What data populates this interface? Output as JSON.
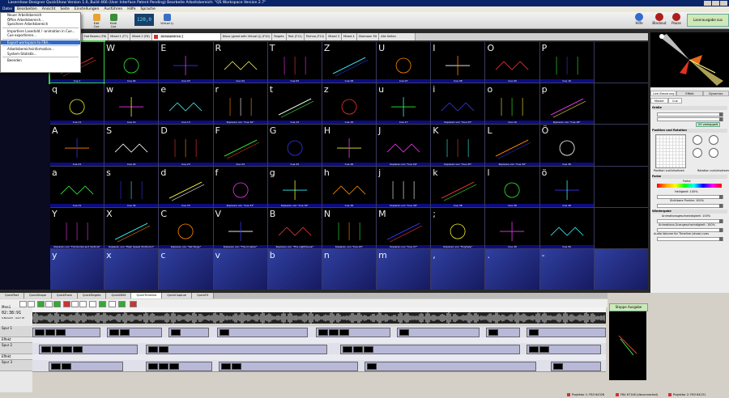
{
  "window": {
    "title": "Lasershow-Designer QuickShow   Version 1.0, Build 466   (User Interface Patent Pending)   Bearbeite Arbeitsbereich: \"QS Workspace Version 2.7\""
  },
  "menu": [
    "Datei",
    "Bearbeiten",
    "Ansicht",
    "Seite",
    "Einstellungen",
    "Ausführen",
    "Hilfe",
    "Sprache"
  ],
  "file_menu": [
    "Neuer Arbeitsbereich",
    "Öffne Arbeitsbereich...",
    "Speichere Arbeitsbereich",
    "Importiere Laserbild / -animation in Cue...",
    "Cue exportieren...",
    "Export workspace to FB4...",
    "Arbeitsbereichsinformation...",
    "System-Statistik...",
    "Beenden"
  ],
  "toolbar": {
    "edit_cue": "Edit Cue",
    "multi_cue": "Multi Cue",
    "lcd_value": "120,0",
    "virtual_lj": "Virtual LJ",
    "help": "Hilfe",
    "blackout": "Blackout",
    "pause": "Pause",
    "laser_output": "Laserausgabe aus"
  },
  "tabs": [
    {
      "label": "Static (F6)"
    },
    {
      "label": "Fans & Beams (F5)"
    },
    {
      "label": "Hot Beams (F6)"
    },
    {
      "label": "Mixed 1 (F7)"
    },
    {
      "label": "Mixed 2 (F8)"
    },
    {
      "label": "Disco (great with Virtual LJ) (F10)"
    },
    {
      "label": "Targets"
    },
    {
      "label": "Test (F11)"
    },
    {
      "label": "Techno (F12)"
    },
    {
      "label": "Mixed 3"
    },
    {
      "label": "Mixed 4"
    },
    {
      "label": "Shomoon 3D"
    }
  ],
  "atmo_tab": "Atmosphärica",
  "all_pages": "Alle Seiten",
  "grid": {
    "rows": [
      [
        {
          "c": "",
          "cap": "Cue 1"
        },
        {
          "c": "W",
          "cap": "Cue 02"
        },
        {
          "c": "E",
          "cap": "Cue 03"
        },
        {
          "c": "R",
          "cap": "Cue 04"
        },
        {
          "c": "T",
          "cap": "Cue 05"
        },
        {
          "c": "Z",
          "cap": "Cue 06"
        },
        {
          "c": "U",
          "cap": "Cue 07"
        },
        {
          "c": "I",
          "cap": "Cue 08"
        },
        {
          "c": "O",
          "cap": "Cue 09"
        },
        {
          "c": "P",
          "cap": "Cue 10"
        },
        {
          "c": "",
          "cap": ""
        }
      ],
      [
        {
          "c": "q",
          "cap": "Cue 11"
        },
        {
          "c": "w",
          "cap": "Cue 12"
        },
        {
          "c": "e",
          "cap": "Cue 13"
        },
        {
          "c": "r",
          "cap": "Kopieren von \"Cue 16\""
        },
        {
          "c": "t",
          "cap": "Cue 15"
        },
        {
          "c": "z",
          "cap": "Cue 16"
        },
        {
          "c": "u",
          "cap": "Cue 17"
        },
        {
          "c": "i",
          "cap": "Kopieren von \"Cue 23\""
        },
        {
          "c": "o",
          "cap": "Cue 19"
        },
        {
          "c": "p",
          "cap": "Kopieren von \"Cue 18\""
        },
        {
          "c": "",
          "cap": ""
        }
      ],
      [
        {
          "c": "A",
          "cap": "Cue 21"
        },
        {
          "c": "S",
          "cap": "Cue 22"
        },
        {
          "c": "D",
          "cap": "Cue 23"
        },
        {
          "c": "F",
          "cap": "Cue 24"
        },
        {
          "c": "G",
          "cap": "Cue 25"
        },
        {
          "c": "H",
          "cap": "Cue 26"
        },
        {
          "c": "J",
          "cap": "Kopieren von \"Cue 29\""
        },
        {
          "c": "K",
          "cap": "Kopieren von \"Cue 25\""
        },
        {
          "c": "L",
          "cap": "Kopieren von \"Cue 30\""
        },
        {
          "c": "Ö",
          "cap": "Cue 30"
        },
        {
          "c": "",
          "cap": ""
        }
      ],
      [
        {
          "c": "a",
          "cap": "Cue 31"
        },
        {
          "c": "s",
          "cap": "Cue 32"
        },
        {
          "c": "d",
          "cap": "Cue 33"
        },
        {
          "c": "f",
          "cap": "Kopieren von \"Cue 33\""
        },
        {
          "c": "g",
          "cap": "Kopieren von \"Cue 32\""
        },
        {
          "c": "h",
          "cap": "Cue 36"
        },
        {
          "c": "j",
          "cap": "Kopieren von \"Cue 36\""
        },
        {
          "c": "k",
          "cap": "Cue 38"
        },
        {
          "c": "l",
          "cap": "Cue 39"
        },
        {
          "c": "ö",
          "cap": "Cue 40"
        },
        {
          "c": "",
          "cap": ""
        }
      ],
      [
        {
          "c": "Y",
          "cap": "Kopieren von \"Horizontal and Vertical\""
        },
        {
          "c": "X",
          "cap": "Kopieren von \"High Speed Multicolor\""
        },
        {
          "c": "C",
          "cap": "Kopieren von \"Set Sings\""
        },
        {
          "c": "V",
          "cap": "Kopieren von \"The Crusher\""
        },
        {
          "c": "B",
          "cap": "Kopieren von \"The Lighthouse\""
        },
        {
          "c": "N",
          "cap": "Kopieren von \"Cue 20\""
        },
        {
          "c": "M",
          "cap": "Kopieren von \"Cue 37\""
        },
        {
          "c": ";",
          "cap": "Kopieren von \"Polyhelp\""
        },
        {
          "c": "",
          "cap": "Cue 49"
        },
        {
          "c": "",
          "cap": "Cue 50"
        },
        {
          "c": "",
          "cap": ""
        }
      ],
      [
        {
          "c": "y",
          "cap": ""
        },
        {
          "c": "x",
          "cap": ""
        },
        {
          "c": "c",
          "cap": ""
        },
        {
          "c": "v",
          "cap": ""
        },
        {
          "c": "b",
          "cap": ""
        },
        {
          "c": "n",
          "cap": ""
        },
        {
          "c": "m",
          "cap": ""
        },
        {
          "c": ",",
          "cap": ""
        },
        {
          "c": ".",
          "cap": ""
        },
        {
          "c": "-",
          "cap": ""
        },
        {
          "c": "",
          "cap": ""
        }
      ]
    ]
  },
  "right_panel": {
    "tabs": [
      "Live-Steuerung",
      "Effekt",
      "Dynamics"
    ],
    "subtabs": [
      "Master",
      "Cue"
    ],
    "size_section": "Größe",
    "xy_linked": "XY verkoppelt",
    "position_section": "Position und Rotation",
    "reset_position": "Position zurücksetzen",
    "reset_rotation": "Rotation zurücksetzen",
    "color_section": "Farbe",
    "color_label": "Farbe",
    "brightness": "Helligkeit: 100%",
    "visible_points": "Sichtbare Punkte: 100%",
    "playback_section": "Wiedergabe",
    "anim_speed": "Animationsgeschwindigkeit: 100%",
    "anim_scan": "Animations-Scangeschwindigkeit: 100%",
    "audio_volume": "Audio Volume for Timeline (show) cues"
  },
  "bottom": {
    "tabs": [
      "QuickText",
      "QuickShape",
      "QuickTrack",
      "QuickTargets",
      "QuickDMX",
      "QuickTimeline",
      "QuickCapture",
      "QuickFX"
    ],
    "selected_tab": "QuickTimeline",
    "menu_label": "Menü",
    "time": "02:38:91",
    "range_label": "S-Bereich - Gut! 0f",
    "tracks": [
      "Spur 1",
      "Effekt",
      "Spur 2",
      "Effekt",
      "Spur 3"
    ],
    "stop_output": "Stoppe Ausgabe",
    "clip_labels": [
      "Cue 8",
      "Cue 22",
      "Cue 22",
      "Projektion 4"
    ]
  },
  "status": {
    "items": [
      "Projektor 1: FB3 64326",
      "FB4 67148 (disconnected)",
      "Projektor 2: FB3 64231"
    ]
  },
  "colors": {
    "accent": "#0a246a",
    "selected": "#3bd13b",
    "caption": "#0c0c80"
  }
}
